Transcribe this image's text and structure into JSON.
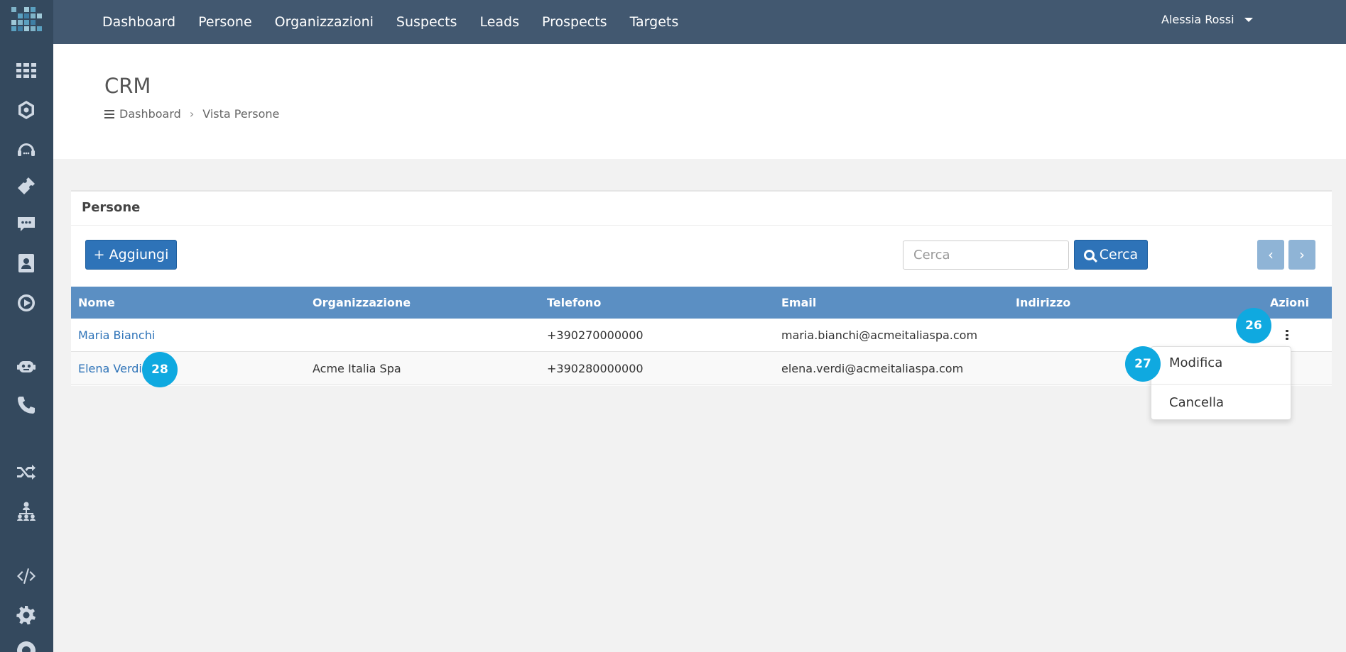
{
  "topnav": {
    "items": [
      "Dashboard",
      "Persone",
      "Organizzazioni",
      "Suspects",
      "Leads",
      "Prospects",
      "Targets"
    ],
    "user": "Alessia Rossi"
  },
  "sidebar": {
    "icons": [
      "grid-icon",
      "hexagon-icon",
      "headset-icon",
      "ticket-icon",
      "chat-icon",
      "contact-card-icon",
      "play-circle-icon",
      "robot-icon",
      "phone-icon",
      "shuffle-icon",
      "org-chart-icon",
      "code-icon",
      "gear-icon",
      "lifebuoy-icon"
    ]
  },
  "header": {
    "title": "CRM",
    "breadcrumb": [
      "Dashboard",
      "Vista Persone"
    ]
  },
  "panel": {
    "title": "Persone",
    "add_label": "+ Aggiungi",
    "search_placeholder": "Cerca",
    "search_button": "Cerca",
    "prev_label": "‹",
    "next_label": "›"
  },
  "table": {
    "columns": [
      "Nome",
      "Organizzazione",
      "Telefono",
      "Email",
      "Indirizzo",
      "Azioni"
    ],
    "rows": [
      {
        "nome": "Maria Bianchi",
        "organizzazione": "",
        "telefono": "+390270000000",
        "email": "maria.bianchi@acmeitaliaspa.com",
        "indirizzo": ""
      },
      {
        "nome": "Elena Verdi",
        "organizzazione": "Acme Italia Spa",
        "telefono": "+390280000000",
        "email": "elena.verdi@acmeitaliaspa.com",
        "indirizzo": ""
      }
    ]
  },
  "dropdown": {
    "items": [
      "Modifica",
      "Cancella"
    ]
  },
  "badges": [
    "26",
    "27",
    "28"
  ],
  "colors": {
    "sidebar": "#34495e",
    "topbar": "#425870",
    "primary": "#2e73b8",
    "table_header": "#5b8fc3",
    "badge": "#0fa9e0"
  }
}
